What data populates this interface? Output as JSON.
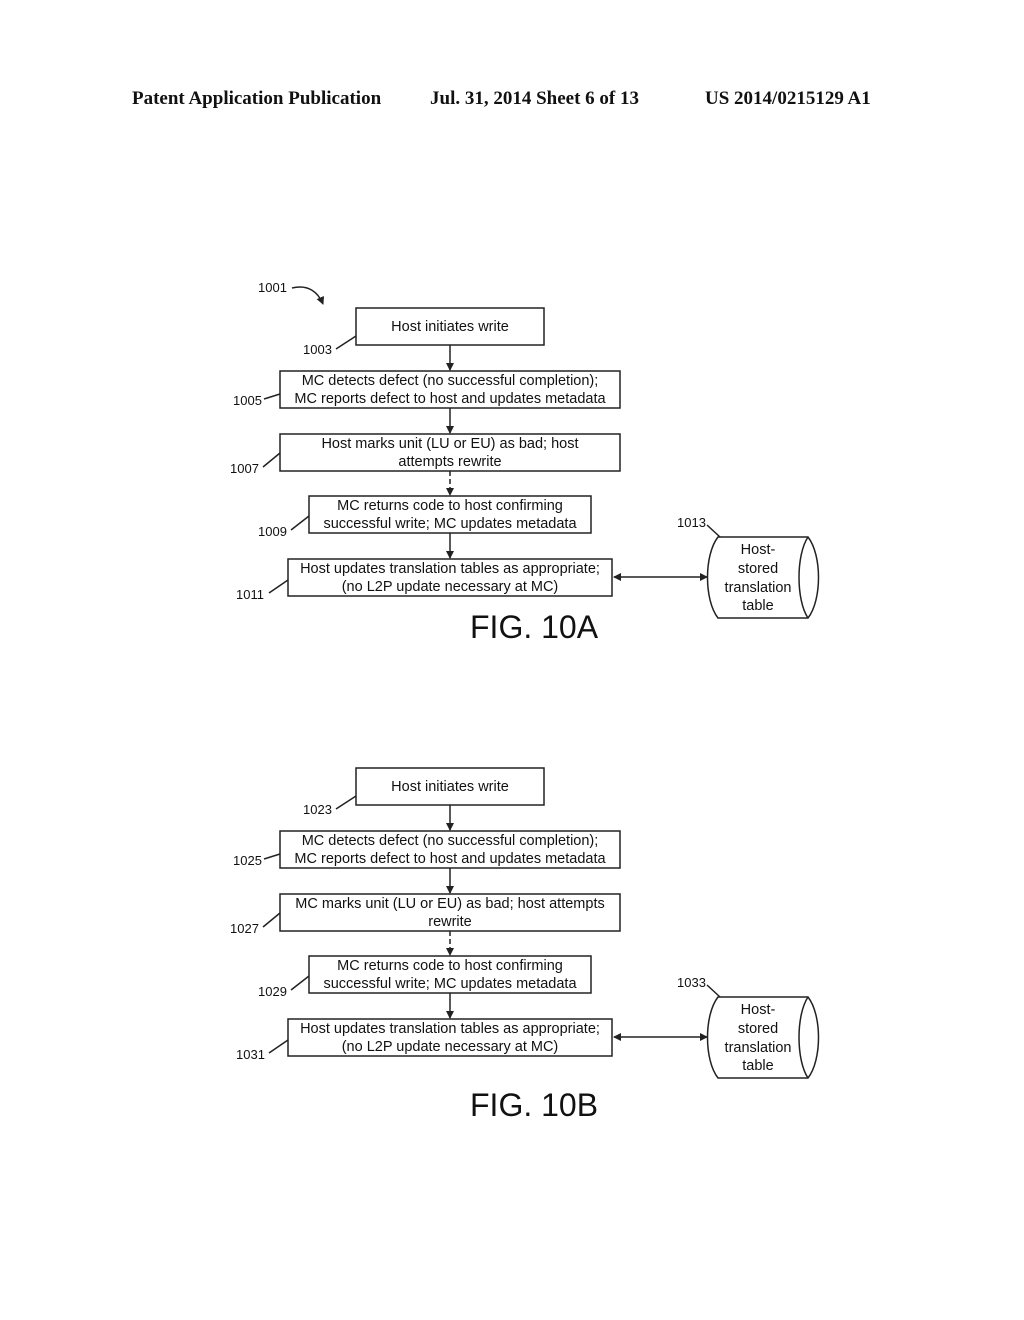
{
  "header": {
    "publication": "Patent Application Publication",
    "date_sheet": "Jul. 31, 2014   Sheet 6 of 13",
    "number": "US 2014/0215129 A1"
  },
  "fig10a": {
    "ref_main": "1001",
    "title": "FIG. 10A",
    "steps": [
      {
        "ref": "1003",
        "line1": "Host initiates write",
        "line2": ""
      },
      {
        "ref": "1005",
        "line1": "MC detects defect (no successful completion);",
        "line2": "MC reports defect to host and updates metadata"
      },
      {
        "ref": "1007",
        "line1": "Host marks unit (LU or EU) as bad; host",
        "line2": "attempts rewrite"
      },
      {
        "ref": "1009",
        "line1": "MC returns code to host confirming",
        "line2": "successful write; MC updates metadata"
      },
      {
        "ref": "1011",
        "line1": "Host updates translation tables as appropriate;",
        "line2": "(no L2P update necessary at MC)"
      }
    ],
    "storage": {
      "ref": "1013",
      "lines": [
        "Host-",
        "stored",
        "translation",
        "table"
      ]
    }
  },
  "fig10b": {
    "title": "FIG. 10B",
    "steps": [
      {
        "ref": "1023",
        "line1": "Host initiates write",
        "line2": ""
      },
      {
        "ref": "1025",
        "line1": "MC detects defect (no successful completion);",
        "line2": "MC reports defect to host and updates metadata"
      },
      {
        "ref": "1027",
        "line1": "MC marks unit (LU or EU) as bad; host attempts",
        "line2": "rewrite"
      },
      {
        "ref": "1029",
        "line1": "MC returns code to host confirming",
        "line2": "successful write; MC updates metadata"
      },
      {
        "ref": "1031",
        "line1": "Host updates translation tables as appropriate;",
        "line2": "(no L2P update necessary at MC)"
      }
    ],
    "storage": {
      "ref": "1033",
      "lines": [
        "Host-",
        "stored",
        "translation",
        "table"
      ]
    }
  }
}
